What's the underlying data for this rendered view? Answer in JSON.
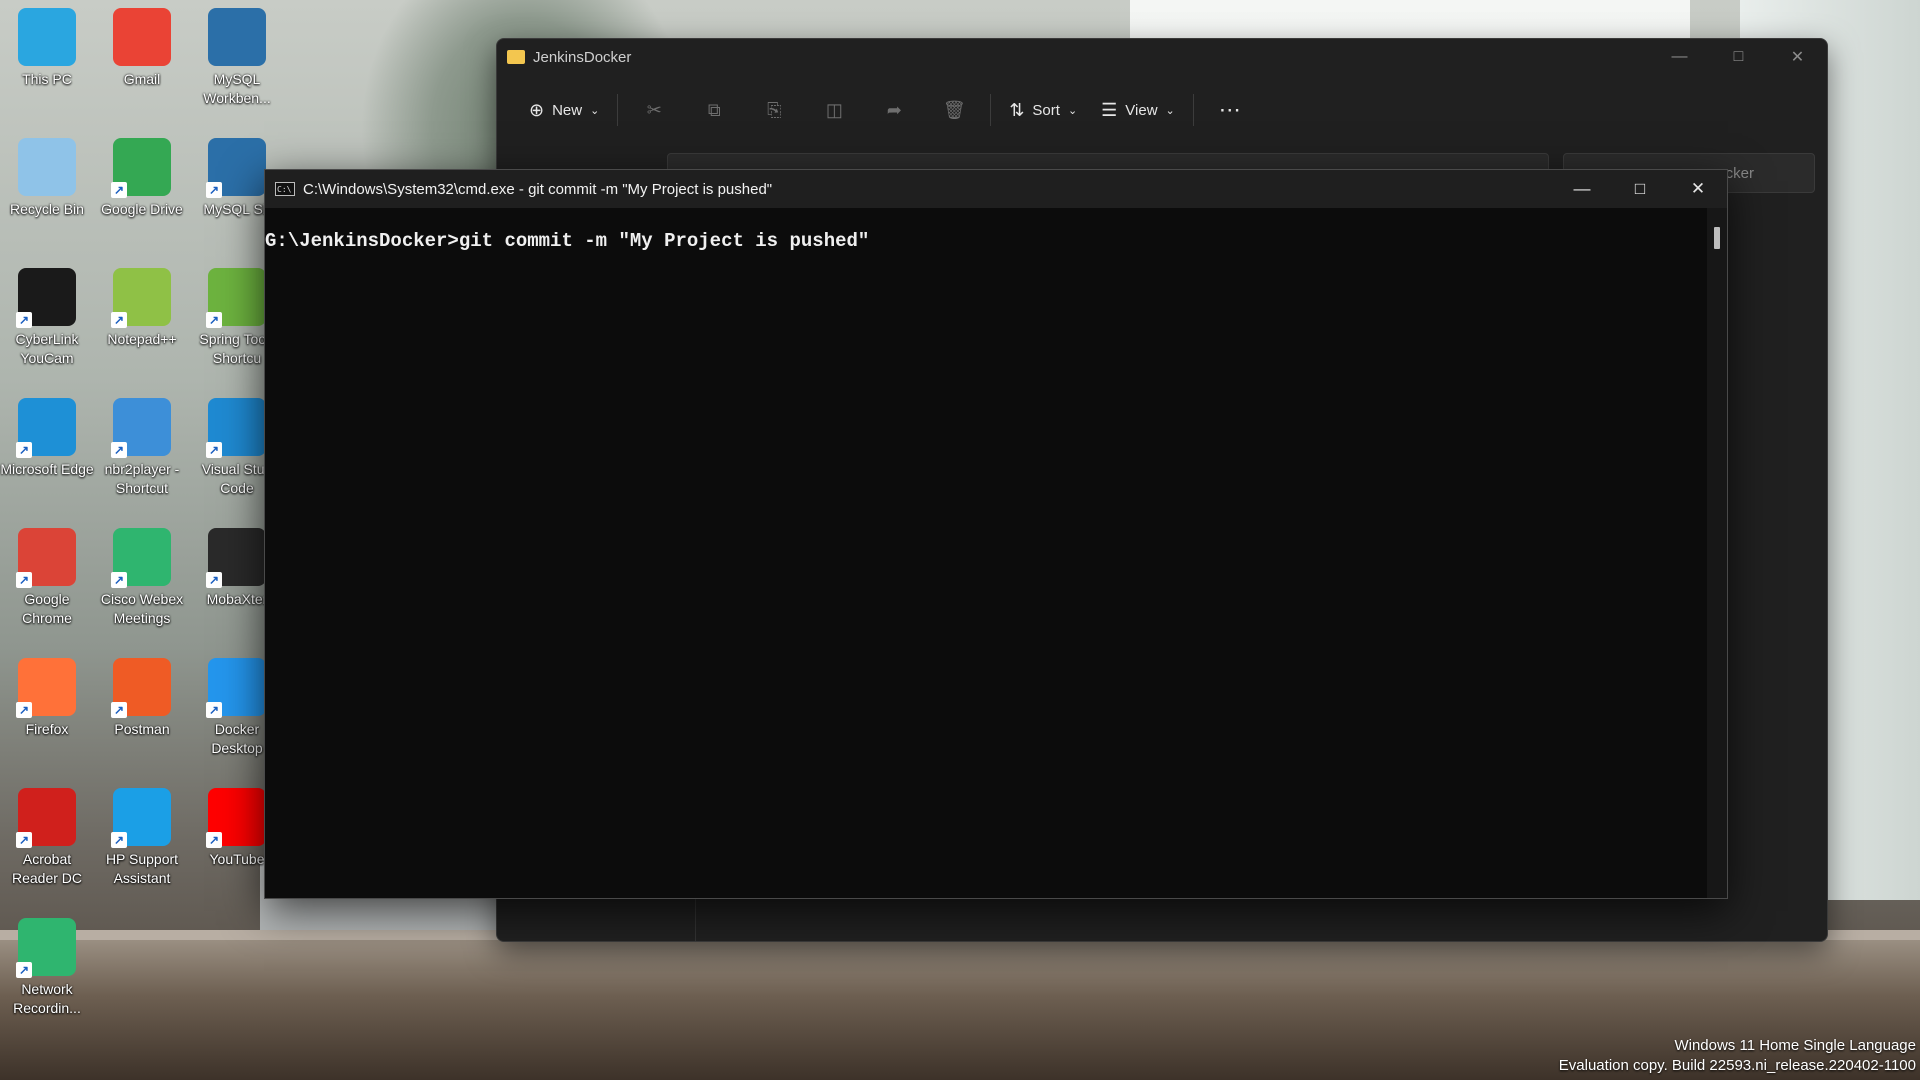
{
  "desktop": {
    "icons": [
      {
        "label": "This PC",
        "icon": "monitor-icon",
        "color": "#2aa6e0"
      },
      {
        "label": "Gmail",
        "icon": "gmail-icon",
        "color": "#ea4335"
      },
      {
        "label": "MySQL Workben...",
        "icon": "mysql-workbench-icon",
        "color": "#2b6fa8"
      },
      {
        "label": "Recycle Bin",
        "icon": "recycle-bin-icon",
        "color": "#8fc3e8"
      },
      {
        "label": "Google Drive",
        "icon": "google-drive-icon",
        "color": "#34a853"
      },
      {
        "label": "MySQL Sh",
        "icon": "mysql-shell-icon",
        "color": "#2b6fa8"
      },
      {
        "label": "CyberLink YouCam",
        "icon": "webcam-icon",
        "color": "#1a1a1a"
      },
      {
        "label": "Notepad++",
        "icon": "notepad-plus-plus-icon",
        "color": "#8fc146"
      },
      {
        "label": "Spring Too - Shortcu",
        "icon": "spring-tool-icon",
        "color": "#6db33f"
      },
      {
        "label": "Microsoft Edge",
        "icon": "edge-icon",
        "color": "#1e90d6"
      },
      {
        "label": "nbr2player - Shortcut",
        "icon": "nbr-player-icon",
        "color": "#3d8fd8"
      },
      {
        "label": "Visual Stud Code",
        "icon": "vscode-icon",
        "color": "#1f8ad2"
      },
      {
        "label": "Google Chrome",
        "icon": "chrome-icon",
        "color": "#db4437"
      },
      {
        "label": "Cisco Webex Meetings",
        "icon": "webex-icon",
        "color": "#2fb56f"
      },
      {
        "label": "MobaXter",
        "icon": "mobaxterm-icon",
        "color": "#2a2a2a"
      },
      {
        "label": "Firefox",
        "icon": "firefox-icon",
        "color": "#ff7139"
      },
      {
        "label": "Postman",
        "icon": "postman-icon",
        "color": "#ef5b25"
      },
      {
        "label": "Docker Desktop",
        "icon": "docker-icon",
        "color": "#2496ed"
      },
      {
        "label": "Acrobat Reader DC",
        "icon": "acrobat-icon",
        "color": "#d0201c"
      },
      {
        "label": "HP Support Assistant",
        "icon": "help-icon",
        "color": "#1b9fe6"
      },
      {
        "label": "YouTube",
        "icon": "youtube-icon",
        "color": "#ff0000"
      },
      {
        "label": "Network Recordin...",
        "icon": "webex-recording-icon",
        "color": "#2fb56f"
      }
    ]
  },
  "explorer": {
    "title": "JenkinsDocker",
    "toolbar": {
      "new_label": "New",
      "sort_label": "Sort",
      "view_label": "View"
    },
    "search_placeholder": "cker"
  },
  "cmd": {
    "title": "C:\\Windows\\System32\\cmd.exe - git  commit -m \"My Project is pushed\"",
    "icon_text": "C:\\",
    "line": "G:\\JenkinsDocker>git commit -m \"My Project is pushed\""
  },
  "watermark": {
    "line1": "Windows 11 Home Single Language",
    "line2": "Evaluation copy. Build 22593.ni_release.220402-1100"
  }
}
